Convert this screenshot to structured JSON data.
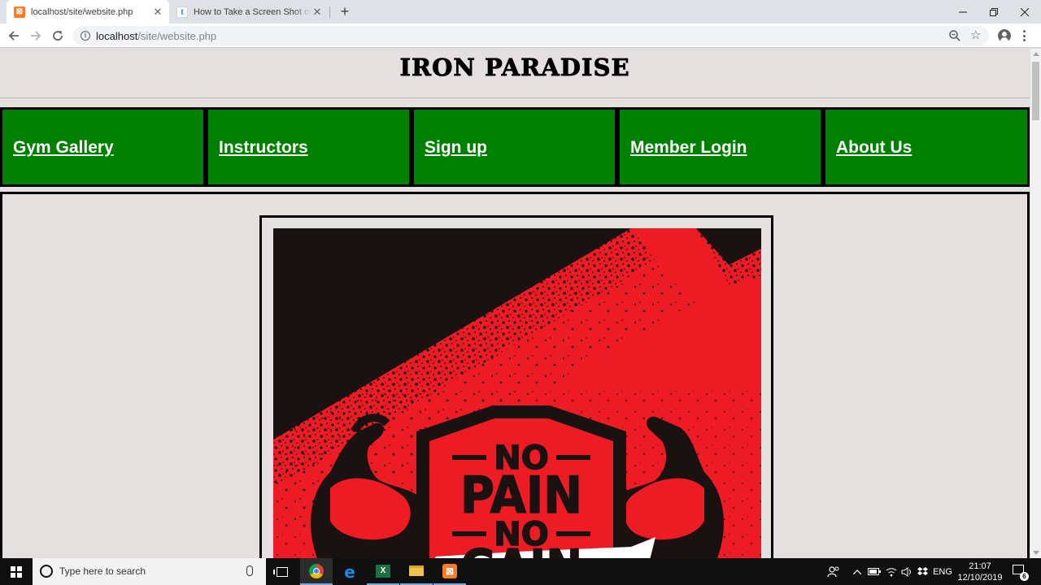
{
  "browser": {
    "tabs": [
      {
        "title": "localhost/site/website.php",
        "favicon": "xampp-icon",
        "active": true
      },
      {
        "title": "How to Take a Screen Shot on a W",
        "favicon": "tumblr-icon",
        "active": false
      }
    ],
    "address": {
      "host": "localhost",
      "path": "/site/website.php"
    }
  },
  "site": {
    "title": "IRON PARADISE",
    "nav": [
      {
        "label": "Gym Gallery"
      },
      {
        "label": "Instructors"
      },
      {
        "label": "Sign up"
      },
      {
        "label": "Member Login"
      },
      {
        "label": "About Us"
      }
    ],
    "poster": {
      "line1": "NO",
      "line2": "PAIN",
      "line3": "NO",
      "line4": "GAIN",
      "colors": {
        "red": "#ed1c24",
        "black": "#1a1111",
        "white": "#ffffff"
      }
    },
    "colors": {
      "nav_green": "#008000",
      "page_bg": "#e3e0df"
    }
  },
  "taskbar": {
    "search_placeholder": "Type here to search",
    "language": "ENG",
    "time": "21:07",
    "date": "12/10/2019",
    "notifications": "6"
  }
}
